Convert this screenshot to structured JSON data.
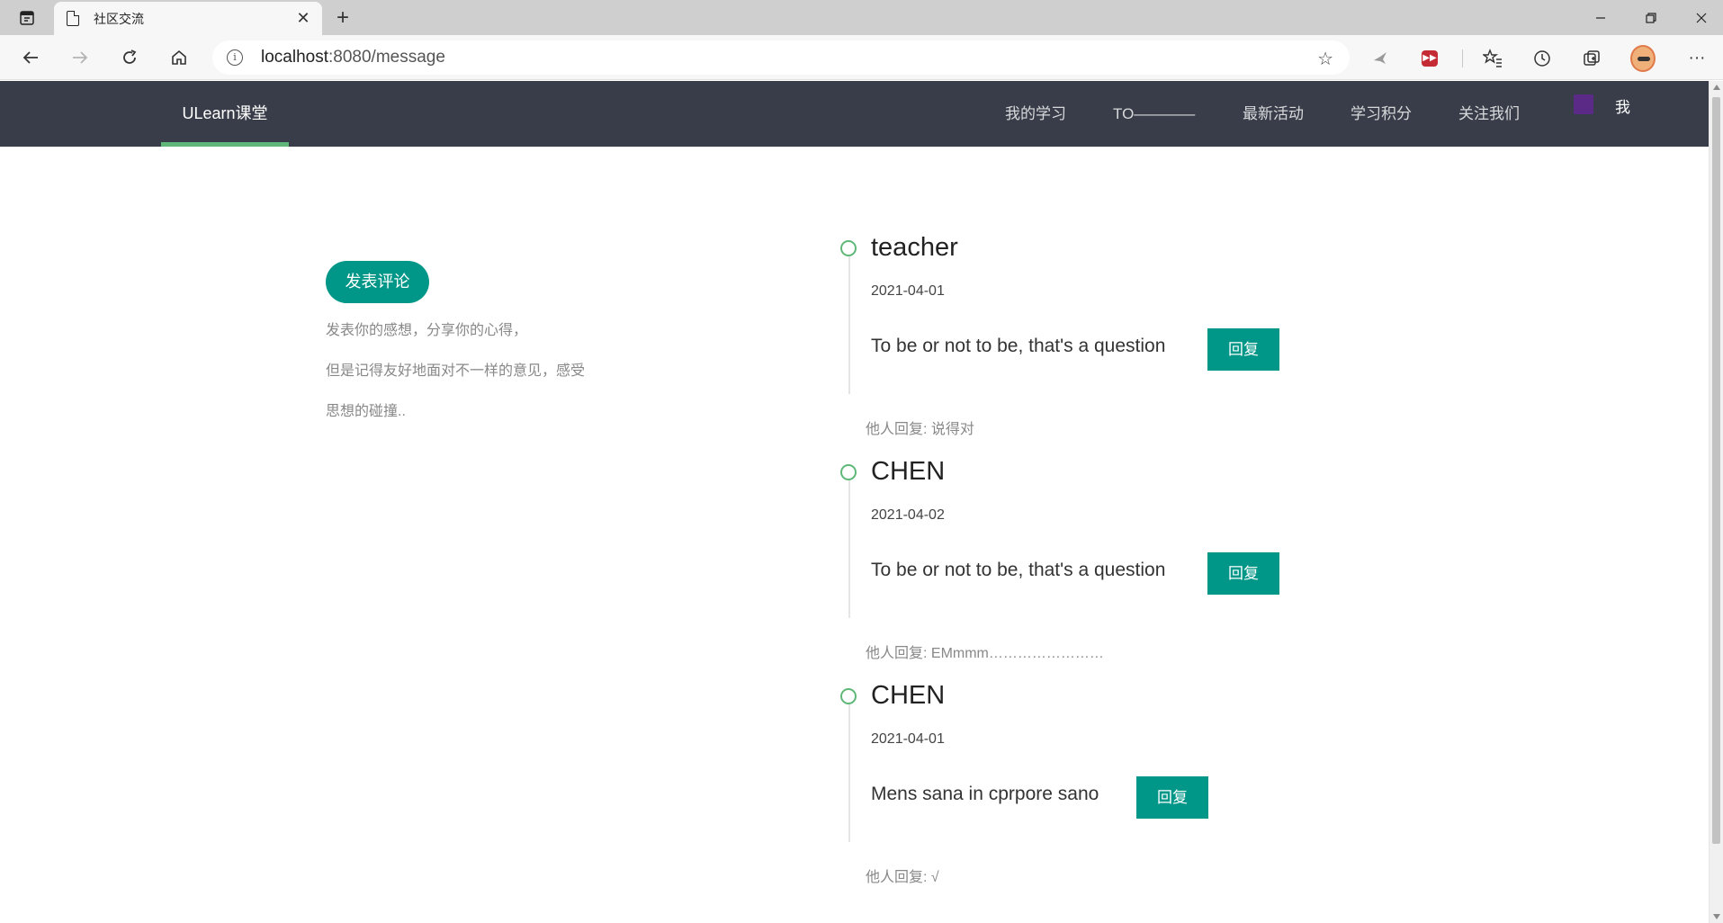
{
  "browser": {
    "tab_title": "社区交流",
    "url_host": "localhost",
    "url_rest": ":8080/message"
  },
  "site": {
    "brand": "ULearn课堂",
    "nav": [
      "我的学习",
      "TO————",
      "最新活动",
      "学习积分",
      "关注我们"
    ],
    "me": "我"
  },
  "sidebar": {
    "post_button": "发表评论",
    "intro_lines": [
      "发表你的感想，分享你的心得，",
      "但是记得友好地面对不一样的意见，感受",
      "思想的碰撞.."
    ]
  },
  "messages": [
    {
      "name": "teacher",
      "date": "2021-04-01",
      "text": "To be or not to be, that's a question",
      "reply_label": "回复",
      "other_reply": "他人回复: 说得对"
    },
    {
      "name": "CHEN",
      "date": "2021-04-02",
      "text": "To be or not to be, that's a question",
      "reply_label": "回复",
      "other_reply": "他人回复: EMmmm……………………"
    },
    {
      "name": "CHEN",
      "date": "2021-04-01",
      "text": "Mens sana in cprpore sano",
      "reply_label": "回复",
      "other_reply": "他人回复: √"
    }
  ],
  "colors": {
    "nav_bg": "#393d49",
    "accent": "#009688",
    "active_bar": "#5fb878"
  }
}
